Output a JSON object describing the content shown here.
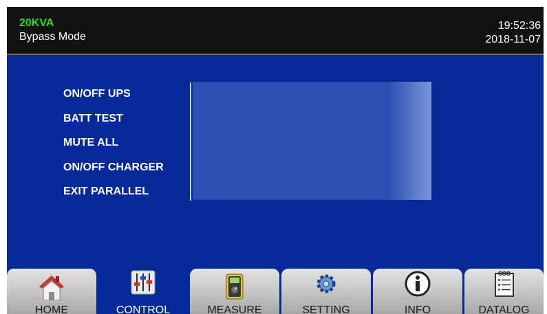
{
  "header": {
    "model": "20KVA",
    "mode": "Bypass Mode",
    "time": "19:52:36",
    "date": "2018-11-07"
  },
  "control_menu": [
    {
      "label": "ON/OFF UPS"
    },
    {
      "label": "BATT TEST"
    },
    {
      "label": "MUTE ALL"
    },
    {
      "label": "ON/OFF CHARGER"
    },
    {
      "label": "EXIT PARALLEL"
    }
  ],
  "tabs": [
    {
      "label": "HOME",
      "icon": "home-icon"
    },
    {
      "label": "CONTROL",
      "icon": "sliders-icon",
      "active": true
    },
    {
      "label": "MEASURE",
      "icon": "multimeter-icon"
    },
    {
      "label": "SETTING",
      "icon": "gear-icon"
    },
    {
      "label": "INFO",
      "icon": "info-icon"
    },
    {
      "label": "DATALOG",
      "icon": "notepad-icon"
    }
  ],
  "colors": {
    "background": "#072a9a",
    "header": "#121212",
    "model_text": "#22e020",
    "panel": "#2a50b3"
  }
}
